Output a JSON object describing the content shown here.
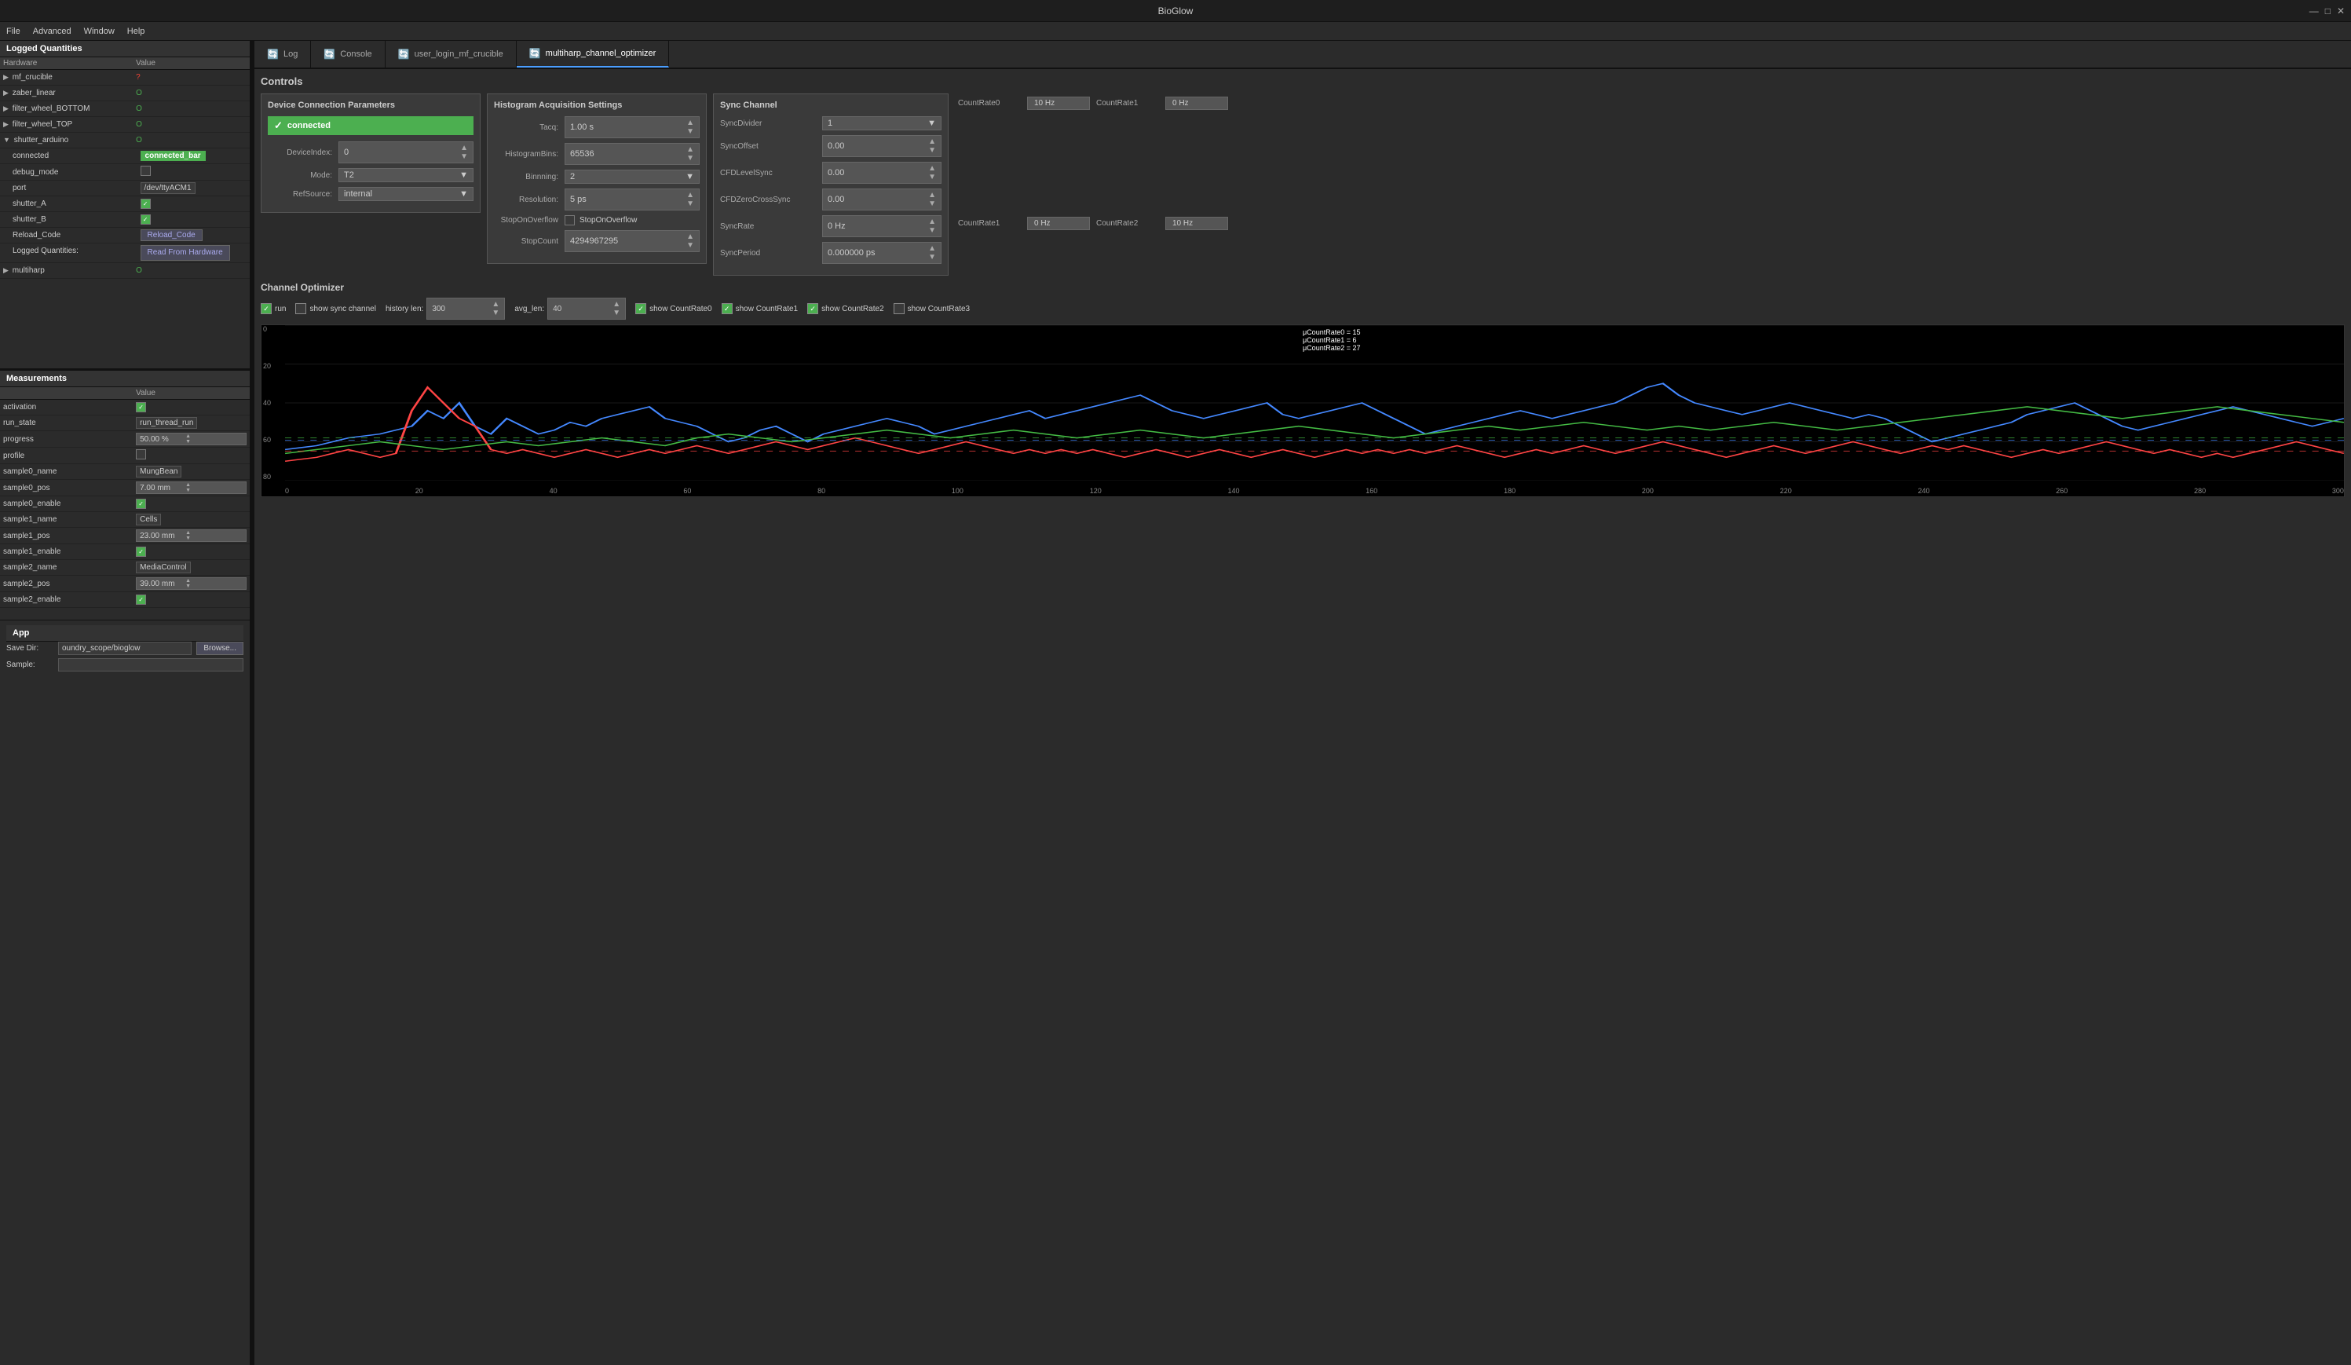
{
  "app": {
    "title": "BioGlow",
    "win_controls": [
      "—",
      "□",
      "✕"
    ]
  },
  "menubar": {
    "items": [
      "File",
      "Advanced",
      "Window",
      "Help"
    ]
  },
  "tabs": [
    {
      "label": "Log",
      "icon": "🔄",
      "active": false
    },
    {
      "label": "Console",
      "icon": "🔄",
      "active": false
    },
    {
      "label": "user_login_mf_crucible",
      "icon": "🔄",
      "active": false
    },
    {
      "label": "multiharp_channel_optimizer",
      "icon": "🔄",
      "active": true
    }
  ],
  "left_panel": {
    "logged_quantities_title": "Logged Quantities",
    "col_headers": [
      "Hardware",
      "Value"
    ],
    "hardware_items": [
      {
        "label": "mf_crucible",
        "value": "?",
        "type": "question",
        "indent": 0,
        "expandable": true
      },
      {
        "label": "zaber_linear",
        "value": "O",
        "type": "green",
        "indent": 0,
        "expandable": true
      },
      {
        "label": "filter_wheel_BOTTOM",
        "value": "O",
        "type": "green",
        "indent": 0,
        "expandable": true
      },
      {
        "label": "filter_wheel_TOP",
        "value": "O",
        "type": "green",
        "indent": 0,
        "expandable": true
      },
      {
        "label": "shutter_arduino",
        "value": "O",
        "type": "green",
        "indent": 0,
        "expandable": true,
        "expanded": true
      },
      {
        "label": "connected",
        "value": "connected_bar",
        "type": "connected_bar",
        "indent": 1
      },
      {
        "label": "debug_mode",
        "value": "",
        "type": "checkbox_empty",
        "indent": 1
      },
      {
        "label": "port",
        "value": "/dev/ttyACM1",
        "type": "text",
        "indent": 1
      },
      {
        "label": "shutter_A",
        "value": "",
        "type": "checkbox_green",
        "indent": 1
      },
      {
        "label": "shutter_B",
        "value": "",
        "type": "checkbox_green",
        "indent": 1
      },
      {
        "label": "Reload_Code",
        "value": "Reload_Code",
        "type": "button",
        "indent": 1
      },
      {
        "label": "Logged Quantities:",
        "value": "Read From Hardware",
        "type": "read_hw",
        "indent": 1
      },
      {
        "label": "multiharp",
        "value": "O",
        "type": "green",
        "indent": 0,
        "expandable": true
      }
    ],
    "measurements_title": "Measurements",
    "meas_col_headers": [
      "",
      "Value"
    ],
    "measurements": [
      {
        "label": "activation",
        "value": "",
        "type": "checkbox_green"
      },
      {
        "label": "run_state",
        "value": "run_thread_run",
        "type": "text"
      },
      {
        "label": "progress",
        "value": "50.00 %",
        "type": "progress_spin"
      },
      {
        "label": "profile",
        "value": "",
        "type": "checkbox_empty"
      },
      {
        "label": "sample0_name",
        "value": "MungBean",
        "type": "text"
      },
      {
        "label": "sample0_pos",
        "value": "7.00 mm",
        "type": "spin"
      },
      {
        "label": "sample0_enable",
        "value": "",
        "type": "checkbox_green"
      },
      {
        "label": "sample1_name",
        "value": "Cells",
        "type": "text"
      },
      {
        "label": "sample1_pos",
        "value": "23.00 mm",
        "type": "spin"
      },
      {
        "label": "sample1_enable",
        "value": "",
        "type": "checkbox_green"
      },
      {
        "label": "sample2_name",
        "value": "MediaControl",
        "type": "text"
      },
      {
        "label": "sample2_pos",
        "value": "39.00 mm",
        "type": "spin"
      },
      {
        "label": "sample2_enable",
        "value": "",
        "type": "checkbox_green"
      }
    ],
    "app_section": {
      "title": "App",
      "save_dir_label": "Save Dir:",
      "save_dir_value": "oundry_scope/bioglow",
      "browse_label": "Browse...",
      "sample_label": "Sample:"
    }
  },
  "controls": {
    "title": "Controls",
    "device_connection": {
      "title": "Device Connection Parameters",
      "connected_label": "connected",
      "device_index_label": "DeviceIndex:",
      "device_index_value": "0",
      "mode_label": "Mode:",
      "mode_value": "T2",
      "ref_source_label": "RefSource:",
      "ref_source_value": "internal"
    },
    "histogram": {
      "title": "Histogram Acquisition Settings",
      "tacq_label": "Tacq:",
      "tacq_value": "1.00 s",
      "histogram_bins_label": "HistogramBins:",
      "histogram_bins_value": "65536",
      "binnning_label": "Binnning:",
      "binnning_value": "2",
      "resolution_label": "Resolution:",
      "resolution_value": "5 ps",
      "stop_overflow_label": "StopOnOverflow",
      "stop_overflow_checked": false,
      "stop_on_overflow_label2": "StopOnOverflow",
      "stop_count_label": "StopCount",
      "stop_count_value": "4294967295"
    },
    "sync_channel": {
      "title": "Sync Channel",
      "sync_divider_label": "SyncDivider",
      "sync_divider_value": "1",
      "sync_offset_label": "SyncOffset",
      "sync_offset_value": "0.00",
      "cfd_level_sync_label": "CFDLevelSync",
      "cfd_level_sync_value": "0.00",
      "cfd_zero_cross_label": "CFDZeroCrossSync",
      "cfd_zero_cross_value": "0.00",
      "sync_rate_label": "SyncRate",
      "sync_rate_value": "0 Hz",
      "sync_period_label": "SyncPeriod",
      "sync_period_value": "0.000000 ps"
    },
    "count_rates": {
      "countrate0_label": "CountRate0",
      "countrate0_value": "10 Hz",
      "countrate1_top_label": "CountRate1",
      "countrate1_top_value": "0 Hz",
      "countrate1_bot_label": "CountRate1",
      "countrate1_bot_value": "0 Hz",
      "countrate2_label": "CountRate2",
      "countrate2_value": "10 Hz"
    }
  },
  "channel_optimizer": {
    "title": "Channel Optimizer",
    "run_label": "run",
    "run_checked": true,
    "show_sync_label": "show sync channel",
    "show_sync_checked": false,
    "history_len_label": "history len:",
    "history_len_value": "300",
    "avg_len_label": "avg_len:",
    "avg_len_value": "40",
    "show_cr0_label": "show CountRate0",
    "show_cr0_checked": true,
    "show_cr1_label": "show CountRate1",
    "show_cr1_checked": true,
    "show_cr2_label": "show CountRate2",
    "show_cr2_checked": true,
    "show_cr3_label": "show CountRate3",
    "show_cr3_checked": false,
    "legend": {
      "cr0": "μCountRate0 = 15",
      "cr1": "μCountRate1 = 6",
      "cr2": "μCountRate2 = 27"
    },
    "chart": {
      "y_labels": [
        "80",
        "60",
        "40",
        "20",
        "0"
      ],
      "x_labels": [
        "0",
        "20",
        "40",
        "60",
        "80",
        "100",
        "120",
        "140",
        "160",
        "180",
        "200",
        "220",
        "240",
        "260",
        "280",
        "300"
      ]
    }
  }
}
